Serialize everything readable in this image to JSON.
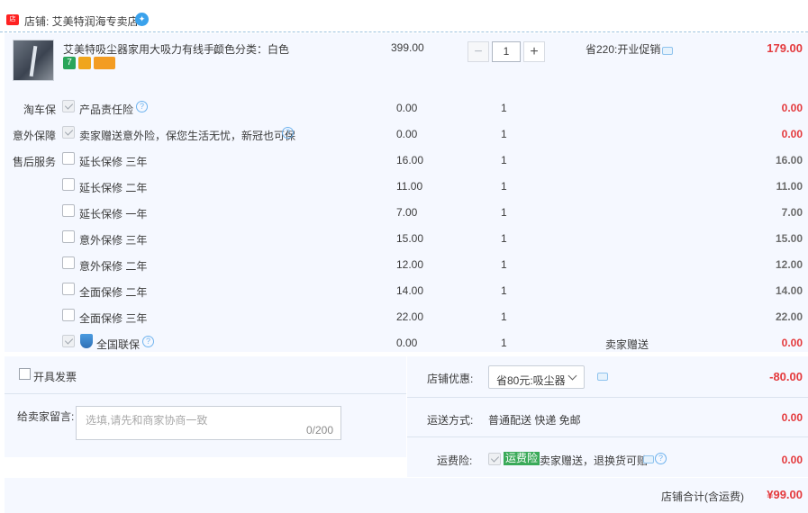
{
  "shop": {
    "name": "店铺: 艾美特润海专卖店"
  },
  "item": {
    "title": "艾美特吸尘器家用大吸力有线手...",
    "attr": "颜色分类：白色",
    "badges": [
      "7",
      "",
      ""
    ],
    "price": "399.00",
    "quantity": "1",
    "minus_label": "−",
    "plus_label": "+",
    "promo": "省220:开业促销",
    "total": "179.00"
  },
  "services": [
    {
      "category": "淘车保",
      "name": "产品责任险",
      "checked": true,
      "help": true,
      "price": "0.00",
      "qty": "1",
      "note": "",
      "total": "0.00",
      "total_color": "red"
    },
    {
      "category": "意外保障",
      "name": "卖家赠送意外险，保您生活无忧，新冠也可保",
      "checked": true,
      "help": true,
      "price": "0.00",
      "qty": "1",
      "note": "",
      "total": "0.00",
      "total_color": "red"
    },
    {
      "category": "售后服务",
      "name": "延长保修 三年",
      "checked": false,
      "help": false,
      "price": "16.00",
      "qty": "1",
      "note": "",
      "total": "16.00",
      "total_color": "gray"
    },
    {
      "category": "",
      "name": "延长保修 二年",
      "checked": false,
      "help": false,
      "price": "11.00",
      "qty": "1",
      "note": "",
      "total": "11.00",
      "total_color": "gray"
    },
    {
      "category": "",
      "name": "延长保修 一年",
      "checked": false,
      "help": false,
      "price": "7.00",
      "qty": "1",
      "note": "",
      "total": "7.00",
      "total_color": "gray"
    },
    {
      "category": "",
      "name": "意外保修 三年",
      "checked": false,
      "help": false,
      "price": "15.00",
      "qty": "1",
      "note": "",
      "total": "15.00",
      "total_color": "gray"
    },
    {
      "category": "",
      "name": "意外保修 二年",
      "checked": false,
      "help": false,
      "price": "12.00",
      "qty": "1",
      "note": "",
      "total": "12.00",
      "total_color": "gray"
    },
    {
      "category": "",
      "name": "全面保修 二年",
      "checked": false,
      "help": false,
      "price": "14.00",
      "qty": "1",
      "note": "",
      "total": "14.00",
      "total_color": "gray"
    },
    {
      "category": "",
      "name": "全面保修 三年",
      "checked": false,
      "help": false,
      "price": "22.00",
      "qty": "1",
      "note": "",
      "total": "22.00",
      "total_color": "gray"
    },
    {
      "category": "",
      "name": "全国联保",
      "checked": true,
      "help": true,
      "price": "0.00",
      "qty": "1",
      "note": "卖家赠送",
      "total": "0.00",
      "total_color": "red"
    }
  ],
  "invoice": {
    "label": "开具发票"
  },
  "message": {
    "label": "给卖家留言:",
    "placeholder": "选填,请先和商家协商一致",
    "count": "0/200"
  },
  "shop_discount": {
    "label": "店铺优惠:",
    "selected": "省80元:吸尘器",
    "value": "-80.00"
  },
  "shipping": {
    "label": "运送方式:",
    "text": "普通配送 快递 免邮",
    "value": "0.00"
  },
  "insurance": {
    "label": "运费险:",
    "tag": "运费险",
    "text": "卖家赠送，退换货可赔",
    "value": "0.00"
  },
  "footer": {
    "label": "店铺合计(含运费)",
    "value": "¥99.00"
  },
  "colors": {
    "accent_red": "#e4393c",
    "panel_bg": "#f5f8ff",
    "link_blue": "#3aa2ec",
    "tag_green": "#3aaa59"
  }
}
